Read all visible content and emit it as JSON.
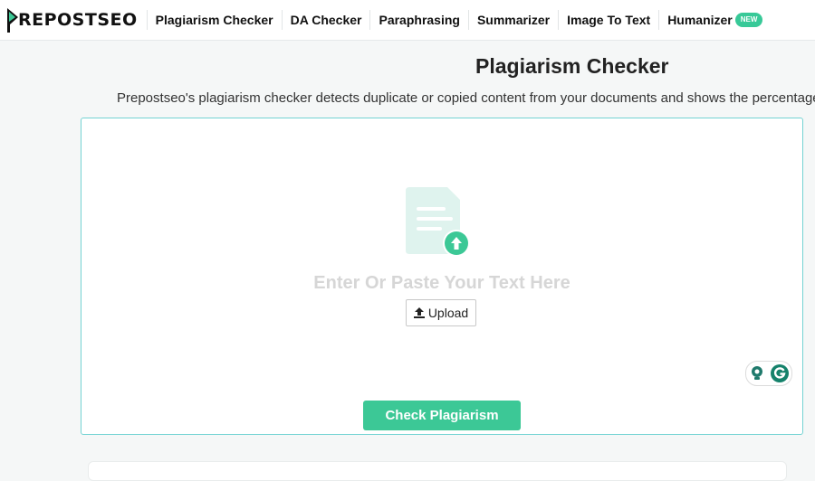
{
  "header": {
    "logo_text": "REPOSTSEO",
    "nav": [
      {
        "label": "Plagiarism Checker"
      },
      {
        "label": "DA Checker"
      },
      {
        "label": "Paraphrasing"
      },
      {
        "label": "Summarizer"
      },
      {
        "label": "Image To Text"
      },
      {
        "label": "Humanizer",
        "badge": "NEW"
      }
    ]
  },
  "main": {
    "title": "Plagiarism Checker",
    "description": "Prepostseo's plagiarism checker detects duplicate or copied content from your documents and shows the percentage of"
  },
  "editor": {
    "placeholder": "Enter Or Paste Your Text Here",
    "upload_label": "Upload",
    "check_label": "Check Plagiarism"
  },
  "colors": {
    "accent": "#3cc896",
    "border": "#74d3d3",
    "icon_light": "#dff3ee"
  },
  "icons": [
    "document-upload-icon",
    "upload-icon",
    "lightbulb-icon",
    "grammarly-icon"
  ]
}
